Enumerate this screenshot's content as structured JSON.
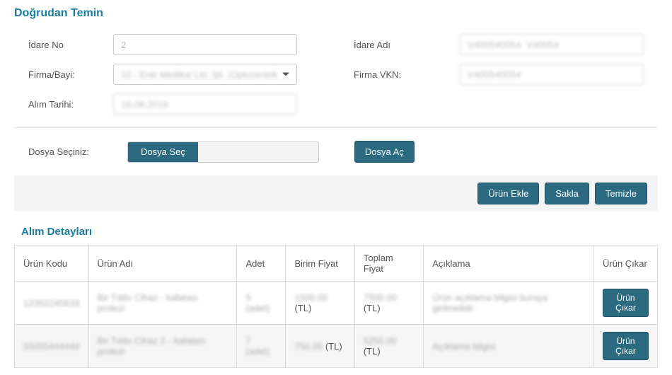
{
  "title": "Doğrudan Temin",
  "form": {
    "idare_no_label": "İdare No",
    "idare_no_value": "2",
    "idare_adi_label": "İdare Adı",
    "idare_adi_value": "V400540054  V40054",
    "firma_label": "Firma/Bayi:",
    "firma_value": "10 - Enki Medikal Ltd. Şti. (Optozentrik...",
    "firma_vkn_label": "Firma VKN:",
    "firma_vkn_value": "V400540054",
    "alim_tarihi_label": "Alım Tarihi:",
    "alim_tarihi_value": "16.08.2016"
  },
  "file": {
    "label": "Dosya Seçiniz:",
    "choose_btn": "Dosya Seç",
    "filename": "",
    "open_btn": "Dosya Aç"
  },
  "actions": {
    "add": "Ürün Ekle",
    "save": "Sakla",
    "clear": "Temizle"
  },
  "detail_title": "Alım Detayları",
  "table": {
    "headers": {
      "kod": "Ürün Kodu",
      "ad": "Ürün Adı",
      "adet": "Adet",
      "birim": "Birim Fiyat",
      "toplam": "Toplam Fiyat",
      "aciklama": "Açıklama",
      "cikar": "Ürün Çıkar"
    },
    "currency": "(TL)",
    "remove_label": "Ürün Çıkar",
    "rows": [
      {
        "kod": "12352245633",
        "ad": "Bir Tıbbı Cihaz - kafatası protezi",
        "adet": "5 (adet)",
        "birim": "1500.00",
        "toplam": "7500.00",
        "aciklama": "Ürün açıklama bilgisi buraya girilmelidir."
      },
      {
        "kod": "55055444444",
        "ad": "Bir Tıbbı Cihaz 2 - kafatası protezi",
        "adet": "7 (adet)",
        "birim": "750.00",
        "toplam": "5250.00",
        "aciklama": "Açıklama bilgisi"
      }
    ]
  }
}
